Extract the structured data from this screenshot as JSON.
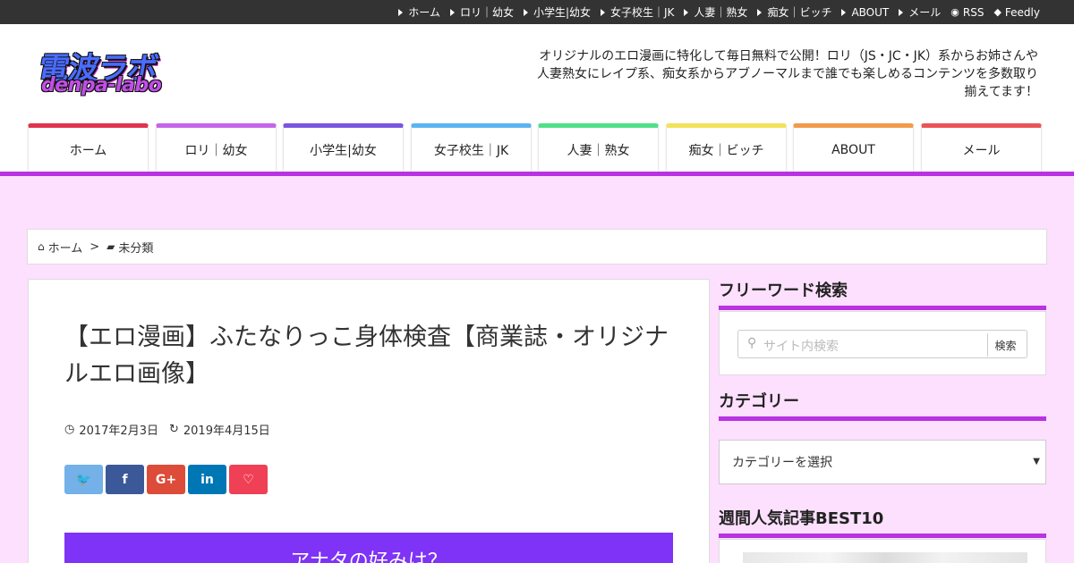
{
  "topnav": {
    "items": [
      {
        "label": "ホーム"
      },
      {
        "label": "ロリ｜幼女"
      },
      {
        "label": "小学生|幼女"
      },
      {
        "label": "女子校生｜JK"
      },
      {
        "label": "人妻｜熟女"
      },
      {
        "label": "痴女｜ビッチ"
      },
      {
        "label": "ABOUT"
      },
      {
        "label": "メール"
      }
    ],
    "rss_label": "RSS",
    "feedly_label": "Feedly"
  },
  "header": {
    "logo_main": "電波ラボ",
    "logo_sub": "denpa-labo",
    "tagline": "オリジナルのエロ漫画に特化して毎日無料で公開！ロリ（JS・JC・JK）系からお姉さんや人妻熟女にレイプ系、痴女系からアブノーマルまで誰でも楽しめるコンテンツを多数取り揃えてます！"
  },
  "mainnav": {
    "items": [
      {
        "label": "ホーム",
        "color": "#e0334f"
      },
      {
        "label": "ロリ｜幼女",
        "color": "#c565e8"
      },
      {
        "label": "小学生|幼女",
        "color": "#7a55e0"
      },
      {
        "label": "女子校生｜JK",
        "color": "#5bb4f0"
      },
      {
        "label": "人妻｜熟女",
        "color": "#4fe08a"
      },
      {
        "label": "痴女｜ビッチ",
        "color": "#f2e25a"
      },
      {
        "label": "ABOUT",
        "color": "#f29a4a"
      },
      {
        "label": "メール",
        "color": "#ea5455"
      }
    ]
  },
  "breadcrumb": {
    "home": "ホーム",
    "separator": ">",
    "category": "未分類"
  },
  "article": {
    "title": "【エロ漫画】ふたなりっこ身体検査【商業誌・オリジナルエロ画像】",
    "published": "2017年2月3日",
    "updated": "2019年4月15日",
    "banner": "アナタの好みは？"
  },
  "share": {
    "buttons": [
      {
        "name": "twitter",
        "glyph": "🐦",
        "color": "#73b1e8"
      },
      {
        "name": "facebook",
        "glyph": "f",
        "color": "#3b5998"
      },
      {
        "name": "google-plus",
        "glyph": "G+",
        "color": "#dd4b39"
      },
      {
        "name": "linkedin",
        "glyph": "in",
        "color": "#0077b5"
      },
      {
        "name": "pocket",
        "glyph": "♡",
        "color": "#ef4056"
      }
    ]
  },
  "sidebar": {
    "search_heading": "フリーワード検索",
    "search_placeholder": "サイト内検索",
    "search_button": "検索",
    "category_heading": "カテゴリー",
    "category_select": "カテゴリーを選択",
    "ranking_heading": "週間人気記事BEST10"
  },
  "colors": {
    "accent": "#b932e3",
    "page_bg": "#fde0fd",
    "banner": "#7e33f6"
  }
}
